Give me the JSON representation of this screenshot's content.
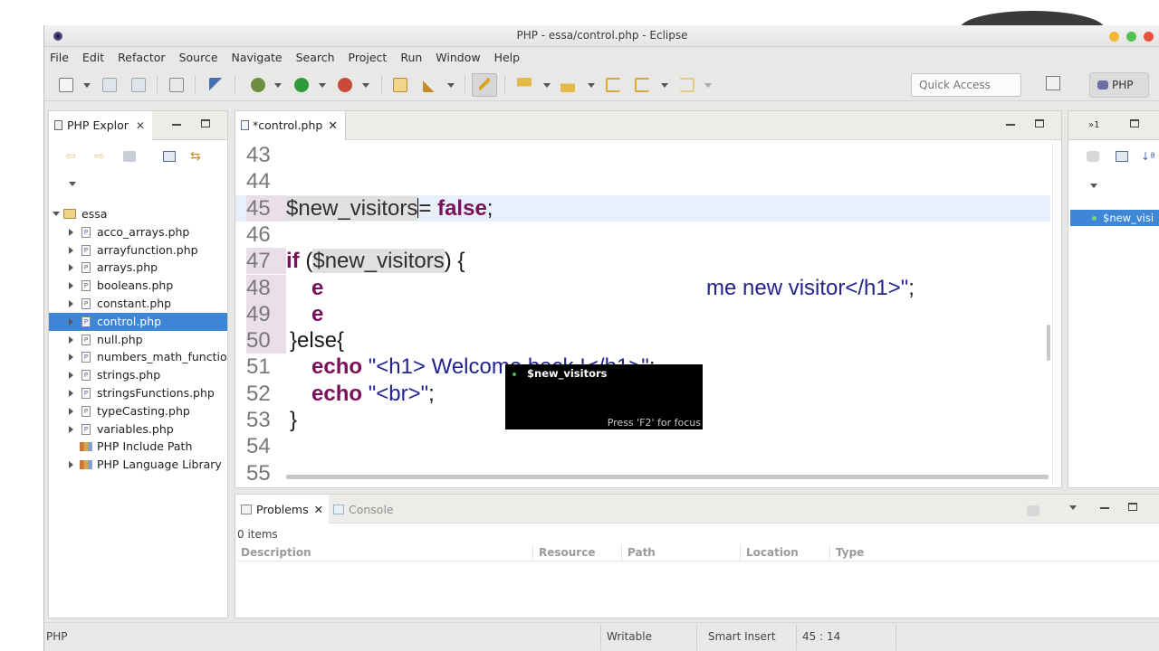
{
  "window": {
    "title": "PHP - essa/control.php - Eclipse"
  },
  "menu": [
    "File",
    "Edit",
    "Refactor",
    "Source",
    "Navigate",
    "Search",
    "Project",
    "Run",
    "Window",
    "Help"
  ],
  "toolbar": {
    "quick_access_placeholder": "Quick Access",
    "perspective_label": "PHP"
  },
  "explorer": {
    "tab_label": "PHP Explor",
    "project": "essa",
    "files": [
      "acco_arrays.php",
      "arrayfunction.php",
      "arrays.php",
      "booleans.php",
      "constant.php",
      "control.php",
      "null.php",
      "numbers_math_functior",
      "strings.php",
      "stringsFunctions.php",
      "typeCasting.php",
      "variables.php"
    ],
    "selected_file": "control.php",
    "include_path": "PHP Include Path",
    "language_library": "PHP Language Library"
  },
  "editor": {
    "tab_label": "*control.php",
    "lines": {
      "l43": {
        "num": "43"
      },
      "l44": {
        "num": "44"
      },
      "l45": {
        "num": "45",
        "var": "$new_visitors",
        "eq": "= ",
        "kw": "false",
        "end": ";"
      },
      "l46": {
        "num": "46"
      },
      "l47": {
        "num": "47",
        "kw": "if",
        "open": " (",
        "var": "$new_visitors",
        "close": ") {"
      },
      "l48": {
        "num": "48",
        "kw": "e",
        "str": "me new visitor</h1>\"",
        "end": ";"
      },
      "l49": {
        "num": "49",
        "kw": "e"
      },
      "l50": {
        "num": "50",
        "text": "}else{"
      },
      "l51": {
        "num": "51",
        "kw": "echo",
        "str": "\"<h1> Welcome back !</h1>\"",
        "end": ";"
      },
      "l52": {
        "num": "52",
        "kw": "echo",
        "str": "\"<br>\"",
        "end": ";"
      },
      "l53": {
        "num": "53",
        "text": "}"
      },
      "l54": {
        "num": "54"
      },
      "l55": {
        "num": "55"
      }
    },
    "hover": {
      "title": "$new_visitors",
      "hint": "Press 'F2' for focus"
    }
  },
  "outline": {
    "tab_count": "»1",
    "item": "$new_visi"
  },
  "problems": {
    "tab_label": "Problems",
    "console_label": "Console",
    "count": "0 items",
    "columns": [
      "Description",
      "Resource",
      "Path",
      "Location",
      "Type"
    ]
  },
  "status": {
    "perspective": "PHP",
    "writable": "Writable",
    "insert_mode": "Smart Insert",
    "position": "45 : 14"
  }
}
